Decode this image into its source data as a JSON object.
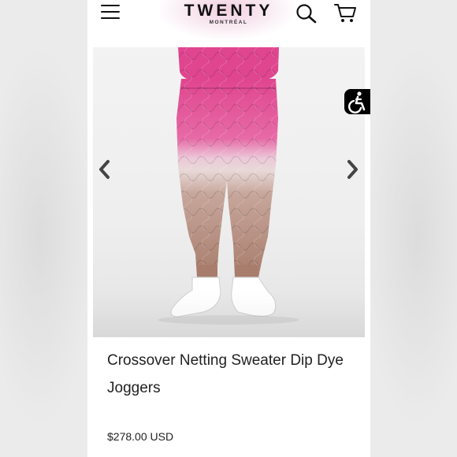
{
  "store": {
    "logo": "TWENTY",
    "logo_subtitle": "MONTRÉAL"
  },
  "header": {
    "menu_icon": "hamburger-menu-icon",
    "search_icon": "search-icon",
    "cart_icon": "cart-icon"
  },
  "gallery": {
    "prev_icon": "chevron-left-icon",
    "next_icon": "chevron-right-icon"
  },
  "accessibility": {
    "icon": "wheelchair-accessibility-icon"
  },
  "product": {
    "title": "Crossover Netting Sweater Dip Dye Joggers",
    "price": "$278.00 USD"
  },
  "colors": {
    "accent_pink": "#e0458f",
    "taupe": "#b08878",
    "text": "#222222"
  }
}
